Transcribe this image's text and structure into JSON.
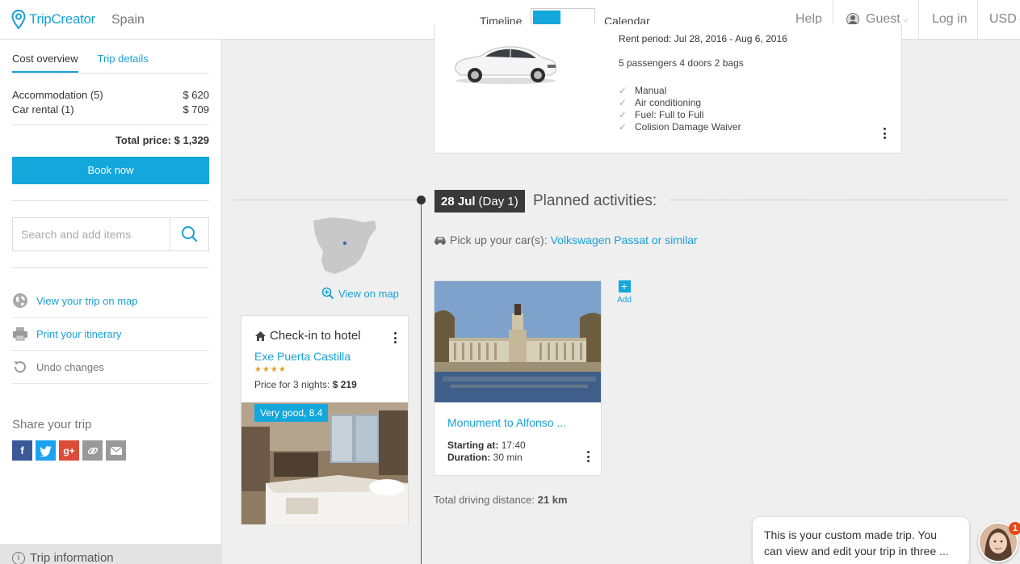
{
  "header": {
    "logo_text": "TripCreator",
    "destination": "Spain",
    "view_left": "Timeline",
    "view_right": "Calendar",
    "help": "Help",
    "guest": "Guest",
    "login": "Log in",
    "currency": "USD",
    "accent": "#13a7dc"
  },
  "sidebar": {
    "tabs": [
      "Cost overview",
      "Trip details"
    ],
    "costs": [
      {
        "label": "Accommodation (5)",
        "value": "$ 620"
      },
      {
        "label": "Car rental (1)",
        "value": "$ 709"
      }
    ],
    "total": "Total price: $ 1,329",
    "book": "Book now",
    "search_placeholder": "Search and add items",
    "actions": [
      {
        "label": "View your trip on map",
        "icon": "globe-icon"
      },
      {
        "label": "Print your itinerary",
        "icon": "printer-icon"
      },
      {
        "label": "Undo changes",
        "icon": "undo-icon"
      }
    ],
    "share_title": "Share your trip",
    "share_icons": [
      "facebook-icon",
      "twitter-icon",
      "googleplus-icon",
      "link-icon",
      "email-icon"
    ],
    "trip_info": "Trip information"
  },
  "car": {
    "rent_period": "Rent period: Jul 28, 2016 - Aug 6, 2016",
    "capacity": "5 passengers 4 doors 2 bags",
    "features": [
      "Manual",
      "Air conditioning",
      "Fuel: Full to Full",
      "Colision Damage Waiver"
    ]
  },
  "day": {
    "date": "28 Jul",
    "day_label": "(Day 1)",
    "planned": "Planned activities:",
    "pickup_prefix": "Pick up your car(s):",
    "pickup_link": "Volkswagen Passat or similar",
    "view_on_map": "View on map"
  },
  "hotel": {
    "title": "Check-in to hotel",
    "name": "Exe Puerta Castilla",
    "stars": "★★★★",
    "price_prefix": "Price for 3 nights:",
    "price": "$ 219",
    "rating": "Very good, 8.4"
  },
  "activity": {
    "name": "Monument to Alfonso ...",
    "start_label": "Starting at:",
    "start": "17:40",
    "duration_label": "Duration:",
    "duration": "30 min"
  },
  "add_label": "Add",
  "driving_label": "Total driving distance:",
  "driving_value": "21 km",
  "chat": {
    "message": "This is your custom made trip. You can view and edit your trip in three ...",
    "badge": "1"
  }
}
